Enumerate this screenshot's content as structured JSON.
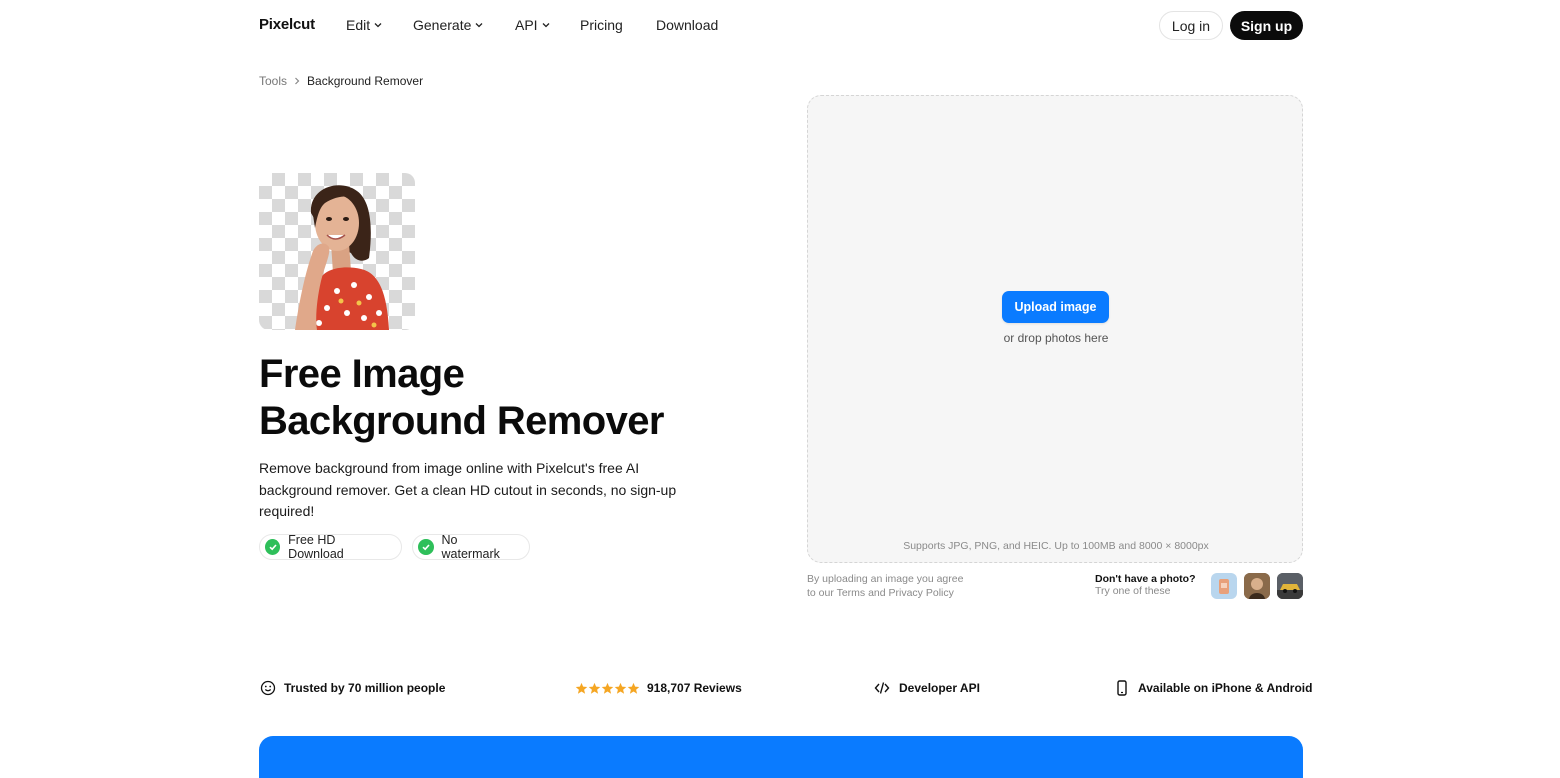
{
  "nav": {
    "logo": "Pixelcut",
    "menu": [
      {
        "label": "Edit",
        "has_dropdown": true
      },
      {
        "label": "Generate",
        "has_dropdown": true
      },
      {
        "label": "API",
        "has_dropdown": true
      },
      {
        "label": "Pricing",
        "has_dropdown": false
      },
      {
        "label": "Download",
        "has_dropdown": false
      }
    ],
    "login": "Log in",
    "signup": "Sign up"
  },
  "breadcrumb": {
    "parent": "Tools",
    "current": "Background Remover"
  },
  "hero": {
    "title_line1": "Free Image",
    "title_line2": "Background Remover",
    "description": "Remove background from image online with Pixelcut's free AI background remover. Get a clean HD cutout in seconds, no sign-up required!",
    "badges": [
      "Free HD Download",
      "No watermark"
    ]
  },
  "uploader": {
    "button": "Upload image",
    "drop_text": "or drop photos here",
    "supports": "Supports JPG, PNG, and HEIC. Up to 100MB and 8000 × 8000px",
    "terms_line1": "By uploading an image you agree",
    "terms_line2": "to our Terms and Privacy Policy",
    "no_photo_title": "Don't have a photo?",
    "no_photo_sub": "Try one of these"
  },
  "trust": {
    "people": "Trusted by 70 million people",
    "reviews": "918,707 Reviews",
    "rating_stars": 5,
    "api": "Developer API",
    "mobile": "Available on iPhone & Android"
  },
  "colors": {
    "accent": "#0a7bff",
    "check": "#2ebf5a",
    "star": "#f5a623",
    "dark_button": "#0b0b0b"
  }
}
